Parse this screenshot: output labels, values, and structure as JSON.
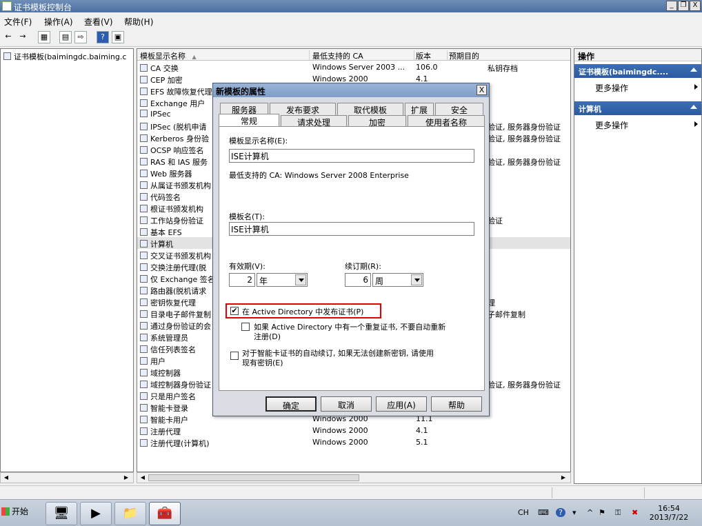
{
  "window": {
    "title": "证书模板控制台",
    "min": "_",
    "restore": "❐",
    "close": "X"
  },
  "menu": [
    "文件(F)",
    "操作(A)",
    "查看(V)",
    "帮助(H)"
  ],
  "toolbar": [
    "←",
    "→",
    "▦",
    "▤",
    "⇨",
    "?",
    "▣"
  ],
  "tree": {
    "root": "证书模板(baimingdc.baiming.c"
  },
  "columns": [
    "模板显示名称",
    "最低支持的 CA",
    "版本",
    "预期目的"
  ],
  "sort_indicator": "▲",
  "rows": [
    [
      "CA 交换",
      "Windows Server 2003 ...",
      "106.0",
      "私钥存档"
    ],
    [
      "CEP 加密",
      "Windows 2000",
      "4.1",
      ""
    ],
    [
      "EFS 故障恢复代理",
      "",
      "",
      ""
    ],
    [
      "Exchange 用户",
      "",
      "",
      ""
    ],
    [
      "IPSec",
      "",
      "",
      ""
    ],
    [
      "IPSec (脱机申请",
      "",
      "",
      "验证, 服务器身份验证"
    ],
    [
      "Kerberos 身份验",
      "",
      "",
      "验证, 服务器身份验证"
    ],
    [
      "OCSP 响应签名",
      "",
      "",
      ""
    ],
    [
      "RAS 和 IAS 服务",
      "",
      "",
      "验证, 服务器身份验证"
    ],
    [
      "Web 服务器",
      "",
      "",
      ""
    ],
    [
      "从属证书颁发机构",
      "",
      "",
      ""
    ],
    [
      "代码签名",
      "",
      "",
      ""
    ],
    [
      "根证书颁发机构",
      "",
      "",
      ""
    ],
    [
      "工作站身份验证",
      "",
      "",
      "验证"
    ],
    [
      "基本 EFS",
      "",
      "",
      ""
    ],
    [
      "计算机",
      "",
      "",
      ""
    ],
    [
      "交叉证书颁发机构",
      "",
      "",
      ""
    ],
    [
      "交换注册代理(脱",
      "",
      "",
      ""
    ],
    [
      "仅 Exchange 签名",
      "",
      "",
      ""
    ],
    [
      "路由器(脱机请求",
      "",
      "",
      ""
    ],
    [
      "密钥恢复代理",
      "",
      "",
      "理"
    ],
    [
      "目录电子邮件复制",
      "",
      "",
      "子邮件复制"
    ],
    [
      "通过身份验证的会",
      "",
      "",
      ""
    ],
    [
      "系统管理员",
      "",
      "",
      ""
    ],
    [
      "信任列表签名",
      "",
      "",
      ""
    ],
    [
      "用户",
      "",
      "",
      ""
    ],
    [
      "域控制器",
      "",
      "",
      ""
    ],
    [
      "域控制器身份验证",
      "",
      "",
      "验证, 服务器身份验证"
    ],
    [
      "只是用户签名",
      "",
      "",
      ""
    ],
    [
      "智能卡登录",
      "",
      "",
      ""
    ],
    [
      "智能卡用户",
      "Windows 2000",
      "11.1",
      ""
    ],
    [
      "注册代理",
      "Windows 2000",
      "4.1",
      ""
    ],
    [
      "注册代理(计算机)",
      "Windows 2000",
      "5.1",
      ""
    ]
  ],
  "actions": {
    "header": "操作",
    "groups": [
      {
        "title": "证书模板(baimingdc....",
        "item": "更多操作"
      },
      {
        "title": "计算机",
        "item": "更多操作"
      }
    ]
  },
  "dialog": {
    "title": "新模板的属性",
    "close": "X",
    "tabs_row1": [
      "服务器",
      "发布要求",
      "取代模板",
      "扩展",
      "安全"
    ],
    "tabs_row2": [
      "常规",
      "请求处理",
      "加密",
      "使用者名称"
    ],
    "display_name_label": "模板显示名称(E):",
    "display_name_value": "ISE计算机",
    "min_ca_text": "最低支持的 CA:  Windows Server 2008 Enterprise",
    "template_name_label": "模板名(T):",
    "template_name_value": "ISE计算机",
    "validity_label": "有效期(V):",
    "validity_value": "2",
    "validity_unit": "年",
    "renewal_label": "续订期(R):",
    "renewal_value": "6",
    "renewal_unit": "周",
    "publish_ad_label": "在 Active Directory 中发布证书(P)",
    "publish_ad_checked": "✔",
    "no_auto_reenroll_label_1": "如果 Active Directory 中有一个重复证书, 不要自动重新",
    "no_auto_reenroll_label_2": "注册(D)",
    "smartcard_label_1": "对于智能卡证书的自动续订, 如果无法创建新密钥, 请使用",
    "smartcard_label_2": "现有密钥(E)",
    "buttons": [
      "确定",
      "取消",
      "应用(A)",
      "帮助"
    ]
  },
  "taskbar": {
    "start": "开始",
    "apps": [
      "🖥",
      "▶",
      "📁",
      "🧰"
    ],
    "lang": "CH",
    "tray_icons": [
      "⌨",
      "?",
      "▾",
      "^",
      "⚑",
      "⚿",
      "✖"
    ],
    "time": "16:54",
    "date": "2013/7/22"
  }
}
